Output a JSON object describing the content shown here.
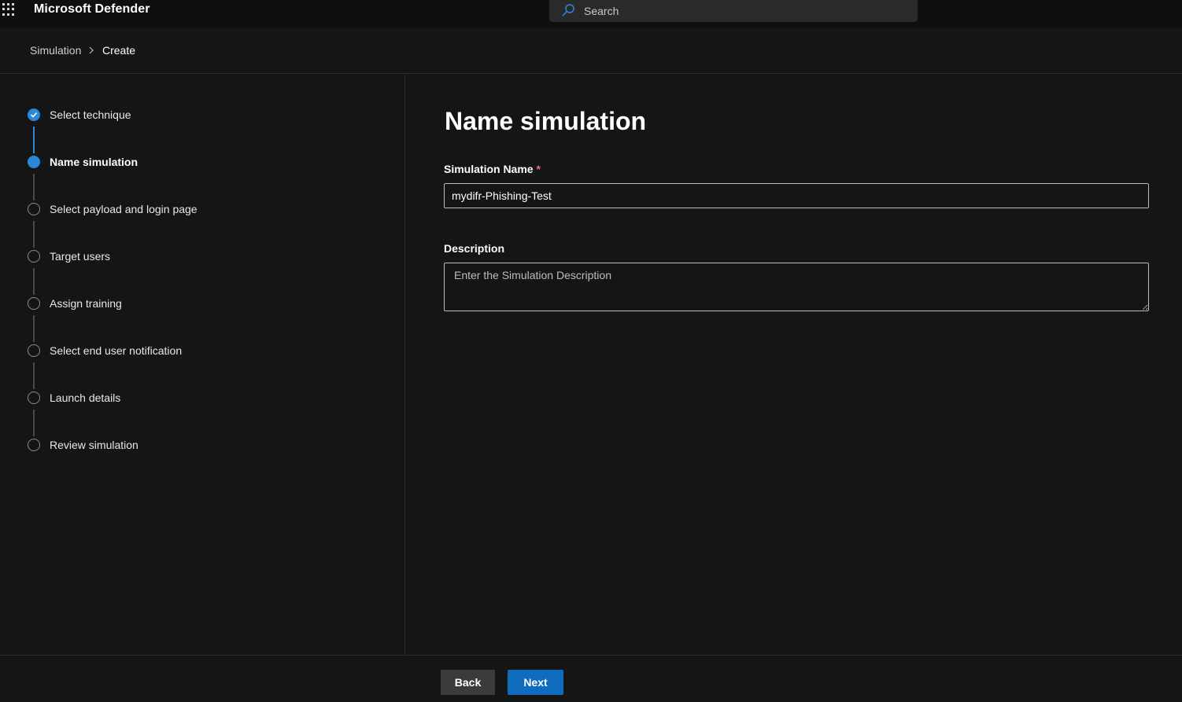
{
  "app": {
    "title": "Microsoft Defender"
  },
  "search": {
    "placeholder": "Search"
  },
  "breadcrumb": {
    "items": [
      "Simulation",
      "Create"
    ]
  },
  "steps": [
    {
      "label": "Select technique",
      "state": "completed"
    },
    {
      "label": "Name simulation",
      "state": "current"
    },
    {
      "label": "Select payload and login page",
      "state": "pending"
    },
    {
      "label": "Target users",
      "state": "pending"
    },
    {
      "label": "Assign training",
      "state": "pending"
    },
    {
      "label": "Select end user notification",
      "state": "pending"
    },
    {
      "label": "Launch details",
      "state": "pending"
    },
    {
      "label": "Review simulation",
      "state": "pending"
    }
  ],
  "form": {
    "title": "Name simulation",
    "name_label": "Simulation Name",
    "required_marker": "*",
    "name_value": "mydifr-Phishing-Test",
    "description_label": "Description",
    "description_placeholder": "Enter the Simulation Description"
  },
  "footer": {
    "back_label": "Back",
    "next_label": "Next"
  },
  "colors": {
    "accent": "#0f6cbd",
    "step_active": "#2b88d8",
    "background": "#151515"
  }
}
